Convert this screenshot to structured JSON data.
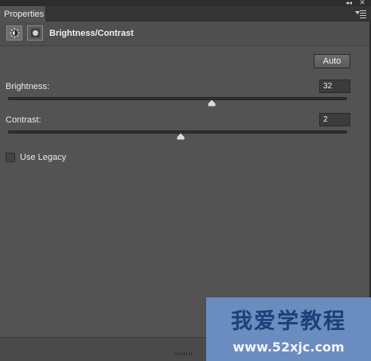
{
  "window": {
    "collapse_glyph": "◂◂",
    "close_glyph": "✕"
  },
  "tab": {
    "label": "Properties"
  },
  "header": {
    "title": "Brightness/Contrast",
    "adjustment_icon": "brightness-contrast-icon",
    "mask_icon": "layer-mask-icon"
  },
  "auto_button": {
    "label": "Auto"
  },
  "brightness": {
    "label": "Brightness:",
    "value": "32",
    "position_fraction": 0.6
  },
  "contrast": {
    "label": "Contrast:",
    "value": "2",
    "position_fraction": 0.51
  },
  "use_legacy": {
    "label": "Use Legacy",
    "checked": false
  },
  "watermark": {
    "line1": "我爱学教程",
    "line2": "www.52xjc.com"
  },
  "colors": {
    "panel": "#535353",
    "watermark_bg": "#6b8cbf",
    "watermark_text": "#1d3f7a"
  }
}
